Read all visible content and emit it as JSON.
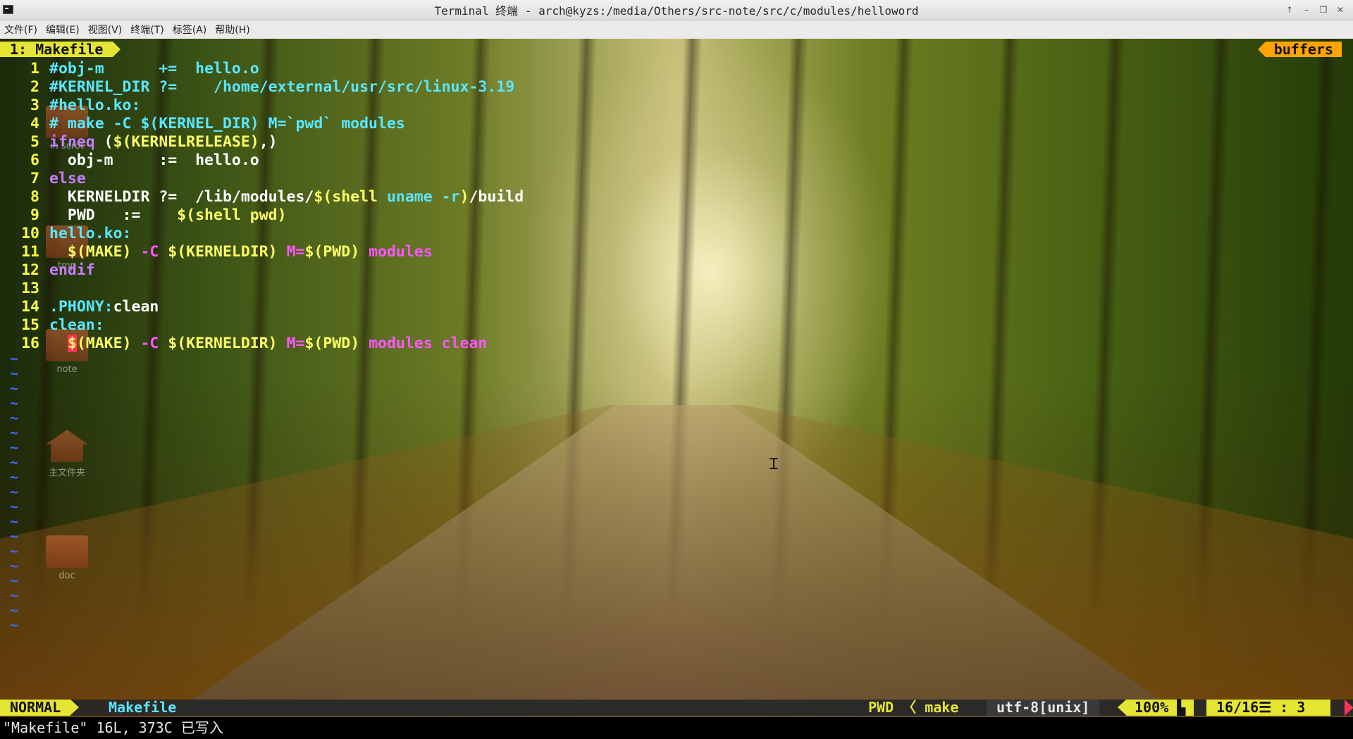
{
  "window": {
    "title": "Terminal 终端 - arch@kyzs:/media/Others/src-note/src/c/modules/helloword",
    "controls": [
      "↑",
      "–",
      "❐",
      "✕"
    ]
  },
  "menu": [
    "文件(F)",
    "编辑(E)",
    "视图(V)",
    "终端(T)",
    "标签(A)",
    "帮助(H)"
  ],
  "desktop_icons": [
    {
      "label": "in scrot"
    },
    {
      "label": "tmp"
    },
    {
      "label": "note"
    },
    {
      "label": "主文件夹"
    },
    {
      "label": "doc"
    }
  ],
  "vim": {
    "tab_label": "1: Makefile",
    "buffers_label": "buffers",
    "lines": [
      {
        "n": "1",
        "segs": [
          {
            "c": "c-cmt",
            "t": "#obj-m      +=  hello.o"
          }
        ]
      },
      {
        "n": "2",
        "segs": [
          {
            "c": "c-cmt",
            "t": "#KERNEL_DIR ?=    /home/external/usr/src/linux-3.19"
          }
        ]
      },
      {
        "n": "3",
        "segs": [
          {
            "c": "c-cmt",
            "t": "#hello.ko:"
          }
        ]
      },
      {
        "n": "4",
        "segs": [
          {
            "c": "c-cmt",
            "t": "# make -C $(KERNEL_DIR) M=`pwd` modules"
          }
        ]
      },
      {
        "n": "5",
        "segs": [
          {
            "c": "c-kw",
            "t": "ifneq "
          },
          {
            "c": "txt",
            "t": "("
          },
          {
            "c": "c-var",
            "t": "$(KERNELRELEASE)"
          },
          {
            "c": "txt",
            "t": ",)"
          }
        ]
      },
      {
        "n": "6",
        "segs": [
          {
            "c": "txt",
            "t": "  obj-m     :=  hello.o"
          }
        ]
      },
      {
        "n": "7",
        "segs": [
          {
            "c": "c-kw",
            "t": "else"
          }
        ]
      },
      {
        "n": "8",
        "segs": [
          {
            "c": "txt",
            "t": "  KERNELDIR ?=  /lib/modules/"
          },
          {
            "c": "c-shl",
            "t": "$(shell "
          },
          {
            "c": "c-cmt",
            "t": "uname -r"
          },
          {
            "c": "c-shl",
            "t": ")"
          },
          {
            "c": "txt",
            "t": "/build"
          }
        ]
      },
      {
        "n": "9",
        "segs": [
          {
            "c": "txt",
            "t": "  PWD   :=    "
          },
          {
            "c": "c-shl",
            "t": "$(shell pwd)"
          }
        ]
      },
      {
        "n": "10",
        "segs": [
          {
            "c": "c-tgt",
            "t": "hello.ko:"
          }
        ]
      },
      {
        "n": "11",
        "segs": [
          {
            "c": "txt",
            "t": "  "
          },
          {
            "c": "c-var",
            "t": "$(MAKE)"
          },
          {
            "c": "c-pnk",
            "t": " -C "
          },
          {
            "c": "c-var",
            "t": "$(KERNELDIR)"
          },
          {
            "c": "c-pnk",
            "t": " M="
          },
          {
            "c": "c-var",
            "t": "$(PWD)"
          },
          {
            "c": "c-pnk",
            "t": " modules"
          }
        ]
      },
      {
        "n": "12",
        "segs": [
          {
            "c": "c-kw",
            "t": "endif"
          }
        ]
      },
      {
        "n": "13",
        "segs": [
          {
            "c": "txt",
            "t": ""
          }
        ]
      },
      {
        "n": "14",
        "segs": [
          {
            "c": "c-cmt",
            "t": ".PHONY:"
          },
          {
            "c": "txt",
            "t": "clean"
          }
        ]
      },
      {
        "n": "15",
        "segs": [
          {
            "c": "c-tgt",
            "t": "clean:"
          }
        ]
      },
      {
        "n": "16",
        "segs": [
          {
            "c": "txt",
            "t": "  "
          },
          {
            "c": "c-cur",
            "t": "$"
          },
          {
            "c": "c-var",
            "t": "(MAKE)"
          },
          {
            "c": "c-pnk",
            "t": " -C "
          },
          {
            "c": "c-var",
            "t": "$(KERNELDIR)"
          },
          {
            "c": "c-pnk",
            "t": " M="
          },
          {
            "c": "c-var",
            "t": "$(PWD)"
          },
          {
            "c": "c-pnk",
            "t": " modules clean"
          }
        ]
      }
    ],
    "tilde_rows": 19,
    "status": {
      "mode": "NORMAL",
      "file": "Makefile",
      "pwd": "PWD 〈 make",
      "encoding": "utf-8[unix]",
      "percent": "100% ▙",
      "position": "16/16☰ :  3"
    },
    "message": "\"Makefile\" 16L, 373C 已写入"
  },
  "colors": {
    "accent_yellow": "#e5e533",
    "accent_orange": "#ffa400",
    "cursor_red": "#ff3355",
    "comment_cyan": "#5ae6ff",
    "keyword_purple": "#c57dff"
  }
}
